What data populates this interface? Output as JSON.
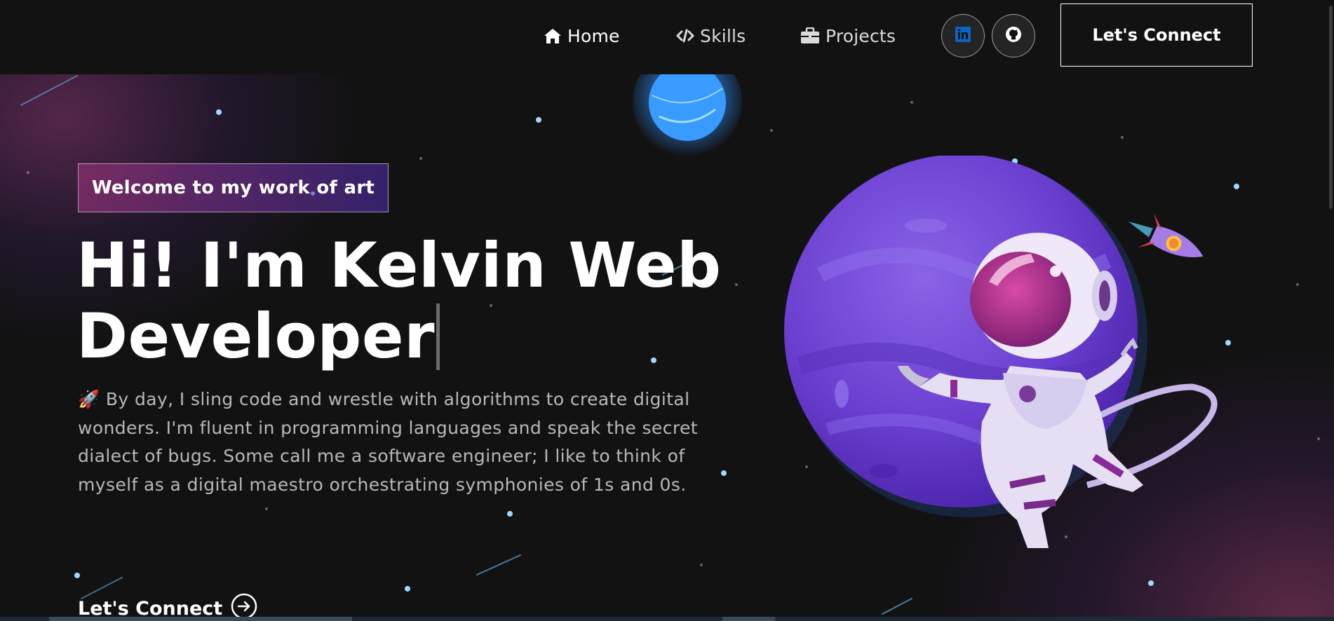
{
  "nav": {
    "links": [
      {
        "label": "Home",
        "icon": "home-icon"
      },
      {
        "label": "Skills",
        "icon": "code-icon"
      },
      {
        "label": "Projects",
        "icon": "briefcase-icon"
      }
    ],
    "social": [
      {
        "name": "LinkedIn",
        "icon": "linkedin-icon",
        "color": "#0a66c2"
      },
      {
        "name": "GitHub",
        "icon": "github-icon",
        "color": "#ffffff"
      }
    ],
    "connect_label": "Let's Connect"
  },
  "hero": {
    "tagline": "Welcome to my work of art",
    "title_line1": "Hi! I'm Kelvin Web",
    "title_line2": "Developer",
    "description": "🚀 By day, I sling code and wrestle with algorithms to create digital wonders. I'm fluent in programming languages and speak the secret dialect of bugs. Some call me a software engineer; I like to think of myself as a digital maestro orchestrating symphonies of 1s and 0s.",
    "cta_label": "Let's Connect",
    "cta_icon": "arrow-right-circle-icon"
  },
  "illustration": {
    "icons": [
      "planet-icon",
      "astronaut-icon",
      "rocket-icon",
      "blue-planet-icon"
    ]
  },
  "colors": {
    "background": "#121212",
    "tag_gradient_start": "#aa367c",
    "tag_gradient_end": "#4a2fbd",
    "planet": "#6a3fd0"
  }
}
